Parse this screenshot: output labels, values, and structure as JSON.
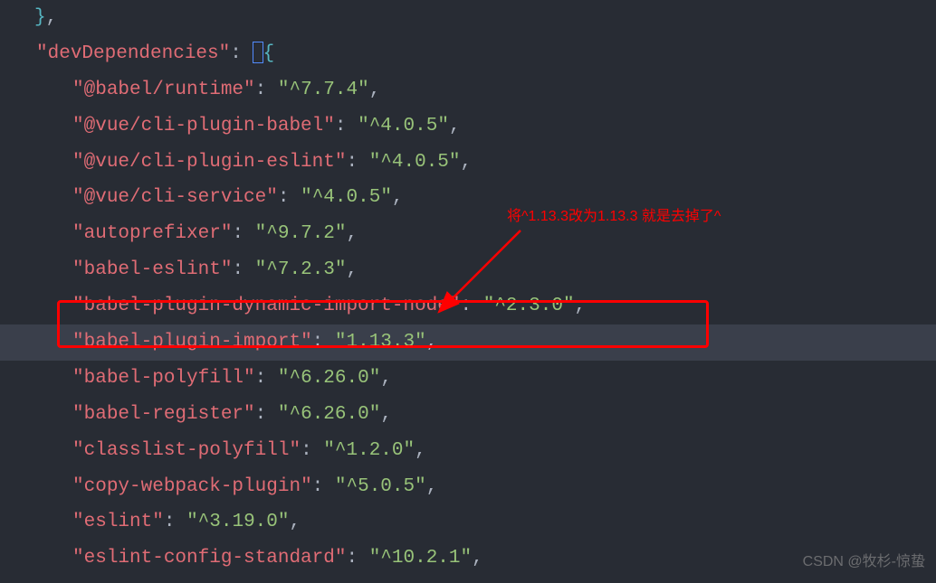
{
  "section_key": "devDependencies",
  "deps": [
    {
      "key": "@babel/runtime",
      "value": "^7.7.4"
    },
    {
      "key": "@vue/cli-plugin-babel",
      "value": "^4.0.5"
    },
    {
      "key": "@vue/cli-plugin-eslint",
      "value": "^4.0.5"
    },
    {
      "key": "@vue/cli-service",
      "value": "^4.0.5"
    },
    {
      "key": "autoprefixer",
      "value": "^9.7.2"
    },
    {
      "key": "babel-eslint",
      "value": "^7.2.3"
    },
    {
      "key": "babel-plugin-dynamic-import-node",
      "value": "^2.3.0"
    },
    {
      "key": "babel-plugin-import",
      "value": "1.13.3"
    },
    {
      "key": "babel-polyfill",
      "value": "^6.26.0"
    },
    {
      "key": "babel-register",
      "value": "^6.26.0"
    },
    {
      "key": "classlist-polyfill",
      "value": "^1.2.0"
    },
    {
      "key": "copy-webpack-plugin",
      "value": "^5.0.5"
    },
    {
      "key": "eslint",
      "value": "^3.19.0"
    },
    {
      "key": "eslint-config-standard",
      "value": "^10.2.1"
    }
  ],
  "partial_line": {
    "key_prefix": "\"",
    "value_prefix": "\"^"
  },
  "annotation_text": "将^1.13.3改为1.13.3 就是去掉了^",
  "watermark_text": "CSDN @牧杉-惊蛰",
  "close_brace": "}",
  "comma": ","
}
